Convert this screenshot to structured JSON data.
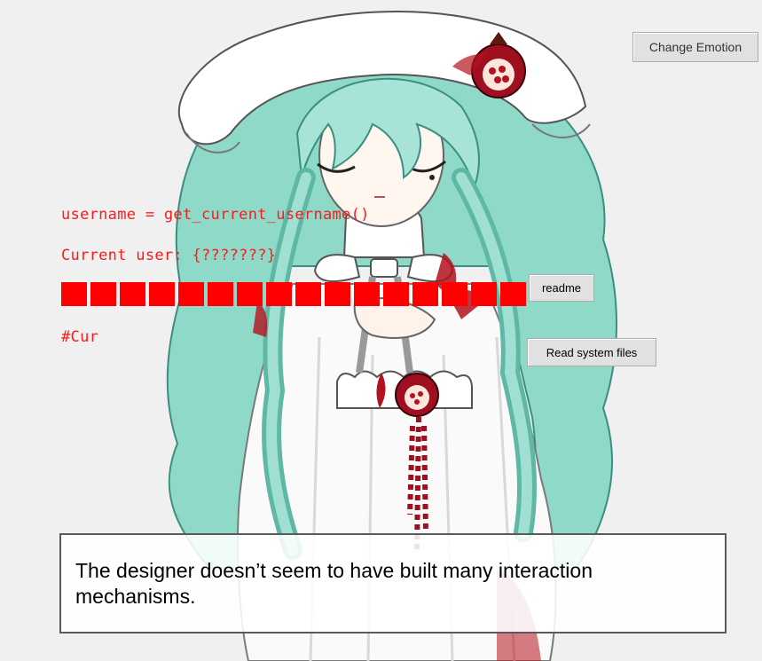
{
  "buttons": {
    "change_emotion": "Change Emotion",
    "readme": "readme",
    "read_system_files": "Read system files"
  },
  "code": {
    "line1": "username = get_current_username()",
    "line2": "Current user: {???????}",
    "line4": "#Cur",
    "censored_blocks": 16
  },
  "dialog": {
    "text": "The designer doesn’t seem to have built many interaction mechanisms."
  },
  "colors": {
    "background": "#f0f0f0",
    "code_text": "#ff1a1a",
    "censor_block": "#ff0000",
    "hair": "#8fd9c9",
    "hair_shadow": "#5fb8a6",
    "dress": "#ffffff",
    "blood": "#b3121e",
    "pomegranate": "#9e1020"
  },
  "icons": {
    "character": "anime-girl-sprite",
    "pomegranate": "pomegranate-icon"
  }
}
